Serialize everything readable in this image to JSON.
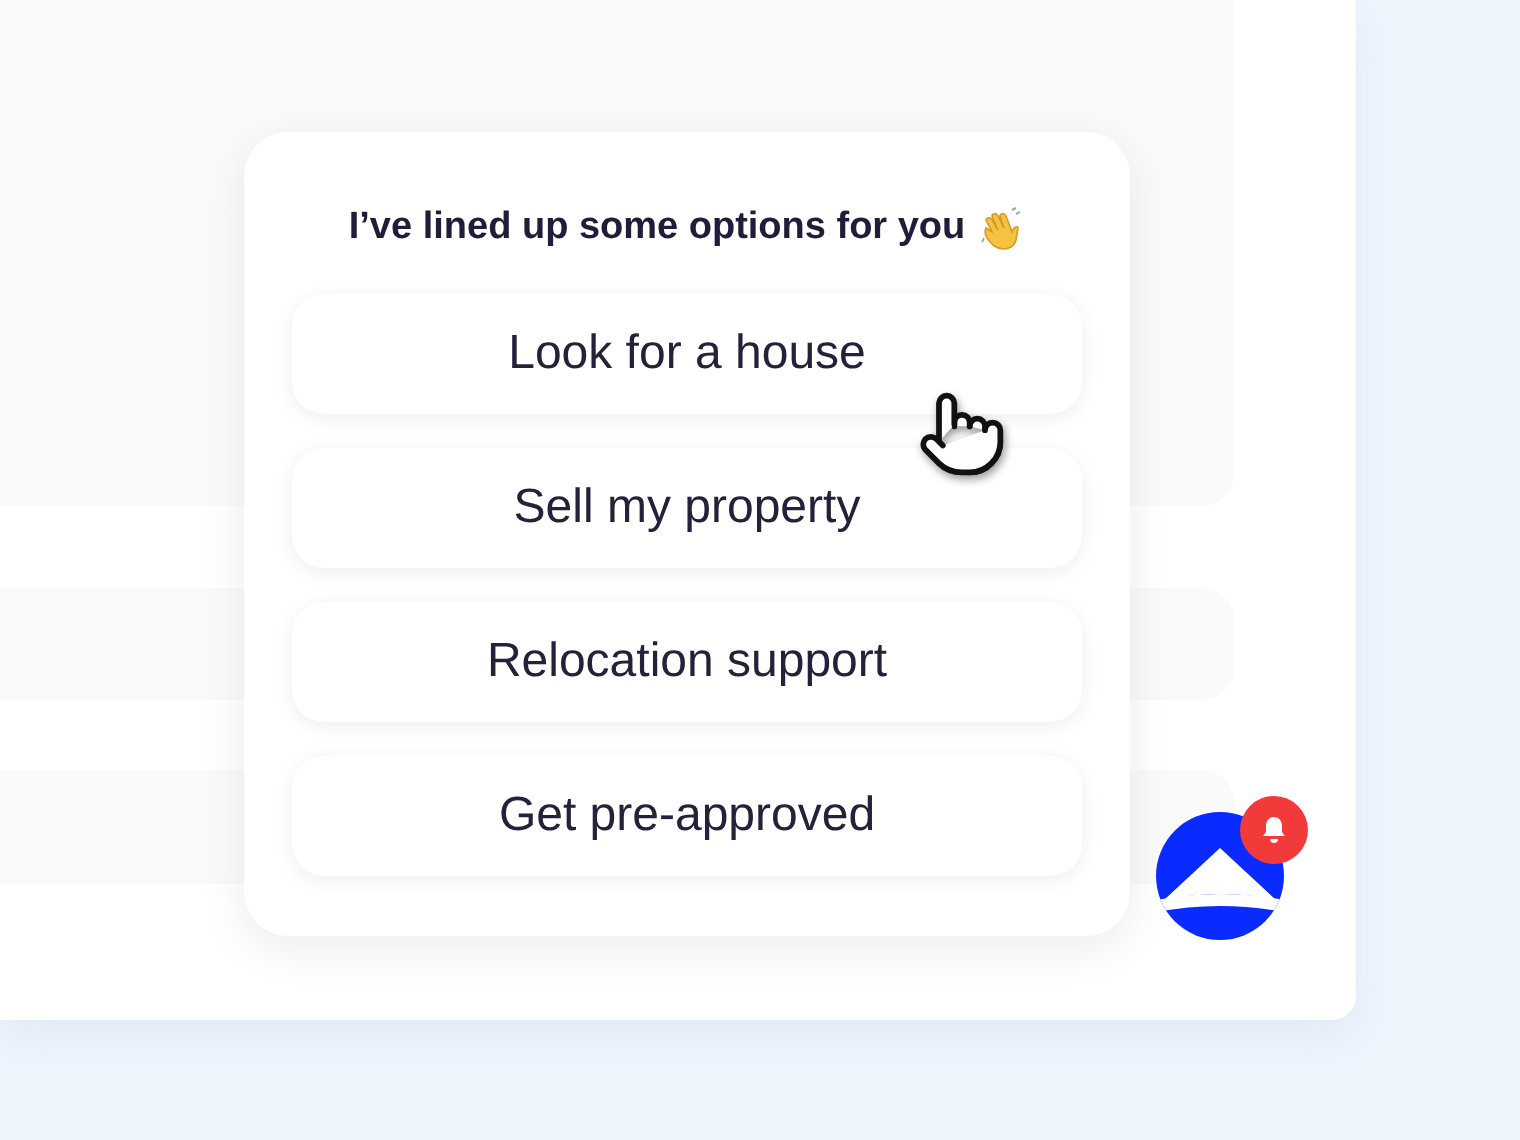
{
  "chat_card": {
    "title": "I’ve lined up some options for you",
    "options": [
      {
        "label": "Look for a house"
      },
      {
        "label": "Sell my property"
      },
      {
        "label": "Relocation support"
      },
      {
        "label": "Get pre-approved"
      }
    ]
  },
  "assistant": {
    "notification": true
  }
}
